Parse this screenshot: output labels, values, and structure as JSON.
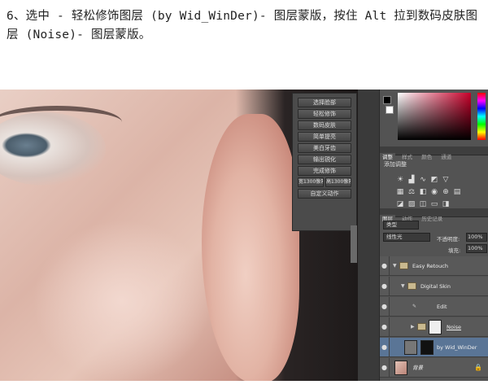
{
  "instruction_text": "6、选中 - 轻松修饰图层 (by Wid_WinDer)- 图层蒙版，按住 Alt 拉到数码皮肤图层 (Noise)- 图层蒙版。",
  "actions_panel": {
    "buttons": [
      "选择脸部",
      "轻松修饰",
      "数码皮肤",
      "简单提亮",
      "美白牙齿",
      "输出锐化",
      "完成修饰"
    ],
    "split_buttons": [
      "宽1300像素",
      "高1300像素"
    ],
    "last_button": "自定义动作"
  },
  "adjust_panel": {
    "tabs": [
      "调整",
      "样式",
      "颜色",
      "通道"
    ],
    "title": "添加调整"
  },
  "layers_panel": {
    "tabs": [
      "图层",
      "动作",
      "历史记录"
    ],
    "filter_kind": "类型",
    "blend_mode": "线性光",
    "opacity_label": "不透明度:",
    "opacity_value": "100%",
    "fill_label": "填充:",
    "fill_value": "100%",
    "layers": [
      {
        "name": "Easy Retouch",
        "kind": "group",
        "level": 0,
        "selected": false
      },
      {
        "name": "Digital Skin",
        "kind": "group",
        "level": 1,
        "selected": false
      },
      {
        "name": "Edit",
        "kind": "layer",
        "level": 2,
        "selected": false
      },
      {
        "name": "Noise",
        "kind": "group-masked",
        "level": 2,
        "selected": false
      },
      {
        "name": "by Wid_WinDer",
        "kind": "layer-masked",
        "level": 1,
        "selected": true
      },
      {
        "name": "背景",
        "kind": "background",
        "level": 0,
        "selected": false
      }
    ]
  },
  "colors": {
    "panel_bg": "#535353",
    "selected_layer": "#5a7596",
    "button_text": "#dddddd"
  },
  "icons": [
    "eye-icon",
    "folder-icon",
    "lock-icon",
    "chevron-down-icon",
    "chevron-right-icon"
  ]
}
